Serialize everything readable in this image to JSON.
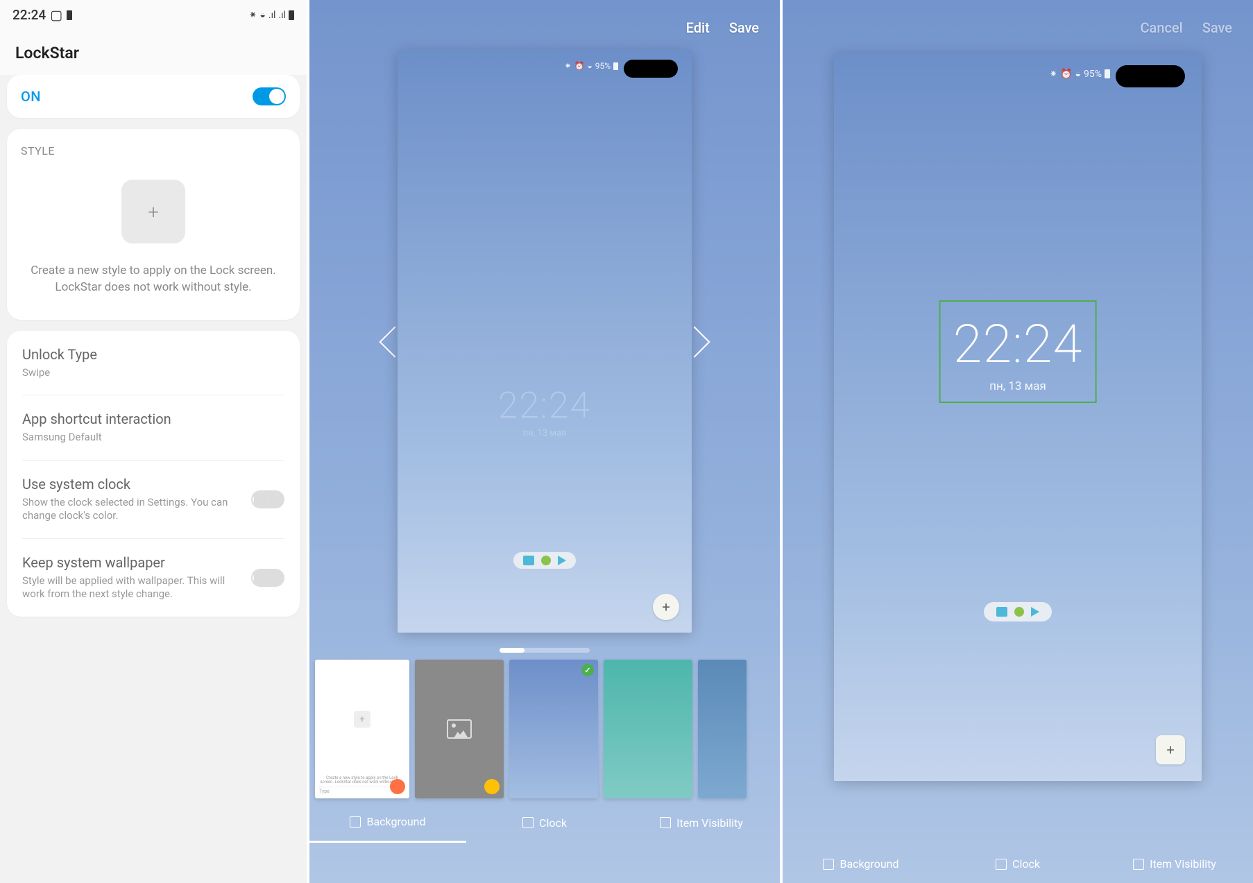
{
  "panel1": {
    "status_time": "22:24",
    "title": "LockStar",
    "on_label": "ON",
    "style_heading": "STYLE",
    "plus_symbol": "+",
    "style_desc_line1": "Create a new style to apply on the Lock screen.",
    "style_desc_line2": "LockStar does not work without style.",
    "items": [
      {
        "title": "Unlock Type",
        "sub": "Swipe",
        "toggle": false
      },
      {
        "title": "App shortcut interaction",
        "sub": "Samsung Default",
        "toggle": false
      },
      {
        "title": "Use system clock",
        "sub": "Show the clock selected in Settings. You can change clock's color.",
        "toggle": true
      },
      {
        "title": "Keep system wallpaper",
        "sub": "Style will be applied with wallpaper. This will work from the next style change.",
        "toggle": true
      }
    ]
  },
  "panel2": {
    "actions": {
      "edit": "Edit",
      "save": "Save"
    },
    "status_text": "95%",
    "clock": {
      "time": "22:24",
      "date": "пн, 13 мая"
    },
    "wp0_desc": "Create a new style to apply on the Lock screen. LockStar does not work without style.",
    "wp0_type": "Type",
    "check": "✓",
    "tabs": {
      "bg": "Background",
      "clock": "Clock",
      "vis": "Item Visibility"
    }
  },
  "panel3": {
    "actions": {
      "cancel": "Cancel",
      "save": "Save"
    },
    "status_text": "95%",
    "clock": {
      "time": "22:24",
      "date": "пн, 13 мая"
    },
    "tabs": {
      "bg": "Background",
      "clock": "Clock",
      "vis": "Item Visibility"
    }
  }
}
